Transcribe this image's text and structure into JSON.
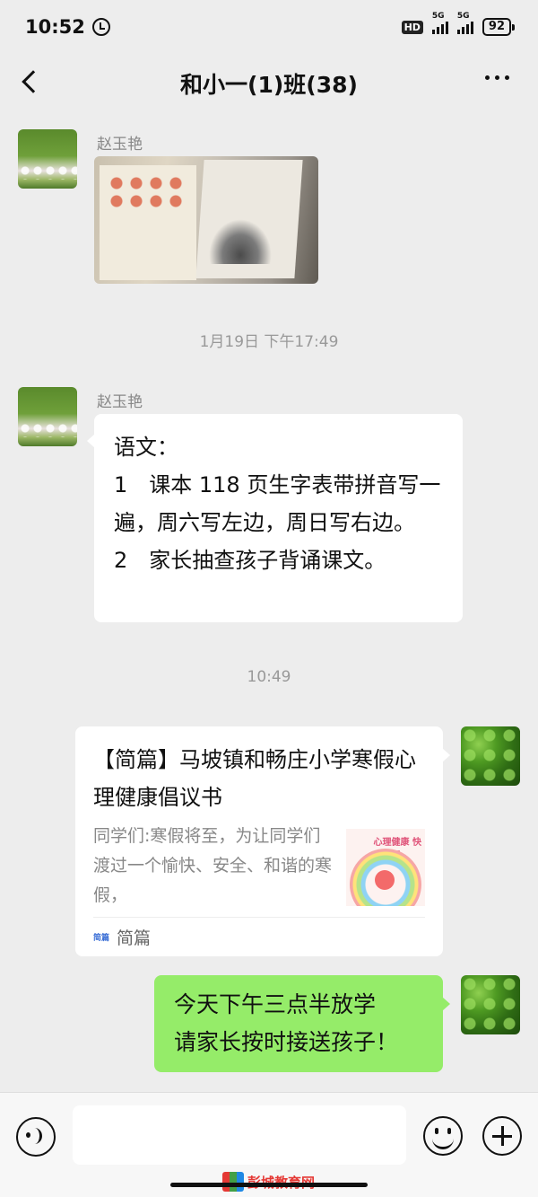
{
  "status_bar": {
    "time": "10:52",
    "hd_label": "HD",
    "net1": "5G",
    "net2": "5G",
    "battery": "92"
  },
  "nav": {
    "title": "和小一(1)班(38)"
  },
  "messages": {
    "m1_sender": "赵玉艳",
    "ts1": "1月19日 下午17:49",
    "m2_sender": "赵玉艳",
    "m2_text": "语文：\n1　课本 118 页生字表带拼音写一遍，周六写左边，周日写右边。\n2　家长抽查孩子背诵课文。",
    "ts2": "10:49",
    "card_title": "【简篇】马坡镇和畅庄小学寒假心理健康倡议书",
    "card_desc": "同学们:寒假将至，为让同学们渡过一个愉快、安全、和谐的寒假，",
    "card_thumb_text": "心理健康 快乐寒假",
    "card_source_icon": "简篇",
    "card_source": "简篇",
    "m4_text": "今天下午三点半放学\n请家长按时接送孩子！"
  },
  "input": {
    "placeholder": ""
  },
  "watermark": {
    "text": "彭城教育网"
  },
  "colors": {
    "background": "#ededed",
    "bubble_self": "#95ec69",
    "bubble_other": "#ffffff"
  }
}
